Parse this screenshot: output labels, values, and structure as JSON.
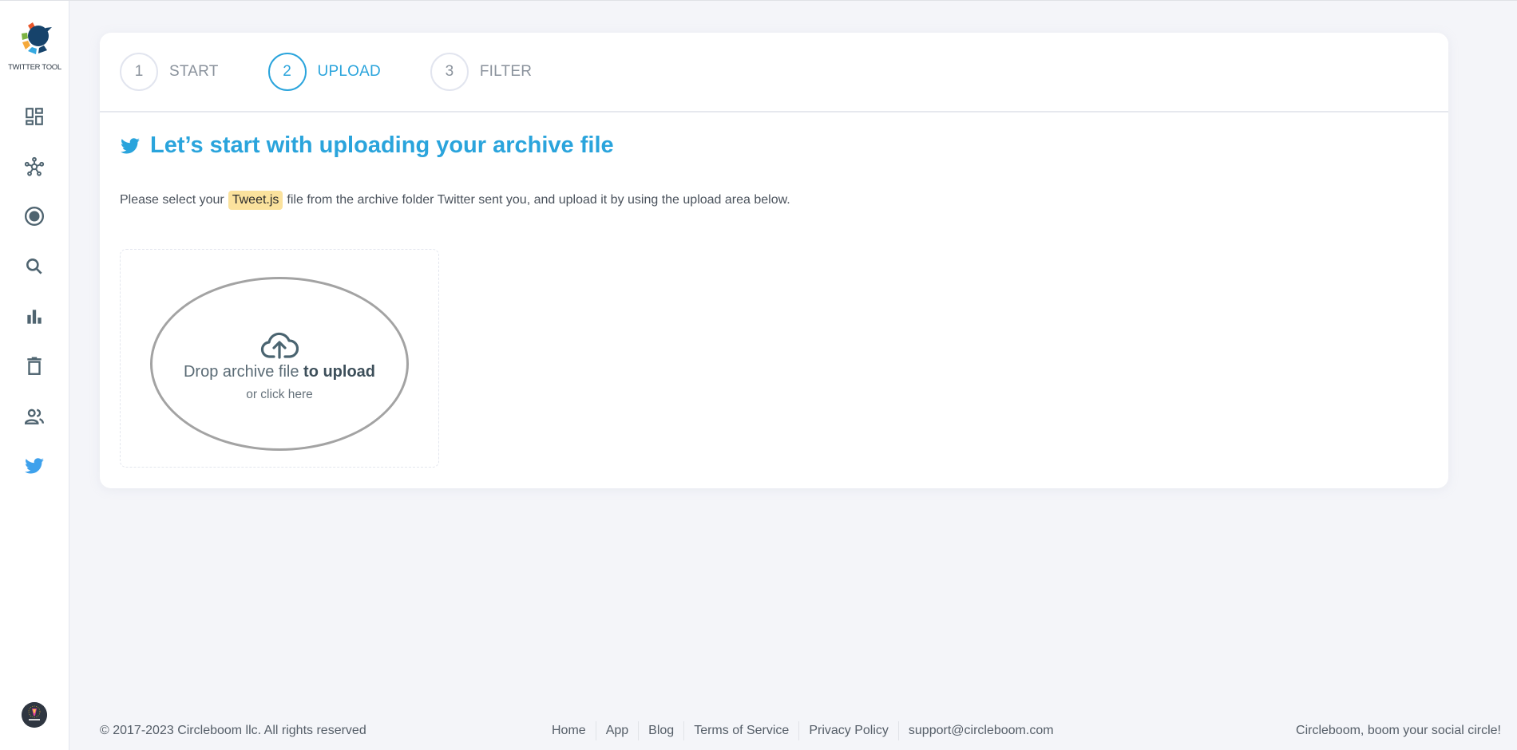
{
  "sidebar": {
    "logo_text": "TWITTER TOOL",
    "logo_colors": [
      "#e8562a",
      "#7cb342",
      "#f5a93b",
      "#35a9e1",
      "#16436b"
    ],
    "items": [
      {
        "icon": "dashboard-icon"
      },
      {
        "icon": "network-icon"
      },
      {
        "icon": "record-circle-icon"
      },
      {
        "icon": "search-icon"
      },
      {
        "icon": "bar-chart-icon"
      },
      {
        "icon": "trash-icon"
      },
      {
        "icon": "users-icon"
      },
      {
        "icon": "twitter-icon",
        "active": true
      }
    ],
    "avatar": "user-avatar"
  },
  "steps": [
    {
      "number": "1",
      "label": "START",
      "active": false
    },
    {
      "number": "2",
      "label": "UPLOAD",
      "active": true
    },
    {
      "number": "3",
      "label": "FILTER",
      "active": false
    }
  ],
  "main": {
    "title": "Let’s start with uploading your archive file",
    "desc_before": "Please select your",
    "desc_highlight": "Tweet.js",
    "desc_after": "file from the archive folder Twitter sent you, and upload it by using the upload area below.",
    "dropzone": {
      "text_normal": "Drop archive file ",
      "text_bold": "to upload",
      "subtext": "or click here"
    }
  },
  "footer": {
    "copyright": "© 2017-2023 Circleboom llc. All rights reserved",
    "links": [
      "Home",
      "App",
      "Blog",
      "Terms of Service",
      "Privacy Policy",
      "support@circleboom.com"
    ],
    "tagline": "Circleboom, boom your social circle!"
  },
  "colors": {
    "accent": "#2aa4dc",
    "icon": "#4f6470",
    "highlight": "#fbe29d",
    "twitter": "#3ea1ec"
  }
}
